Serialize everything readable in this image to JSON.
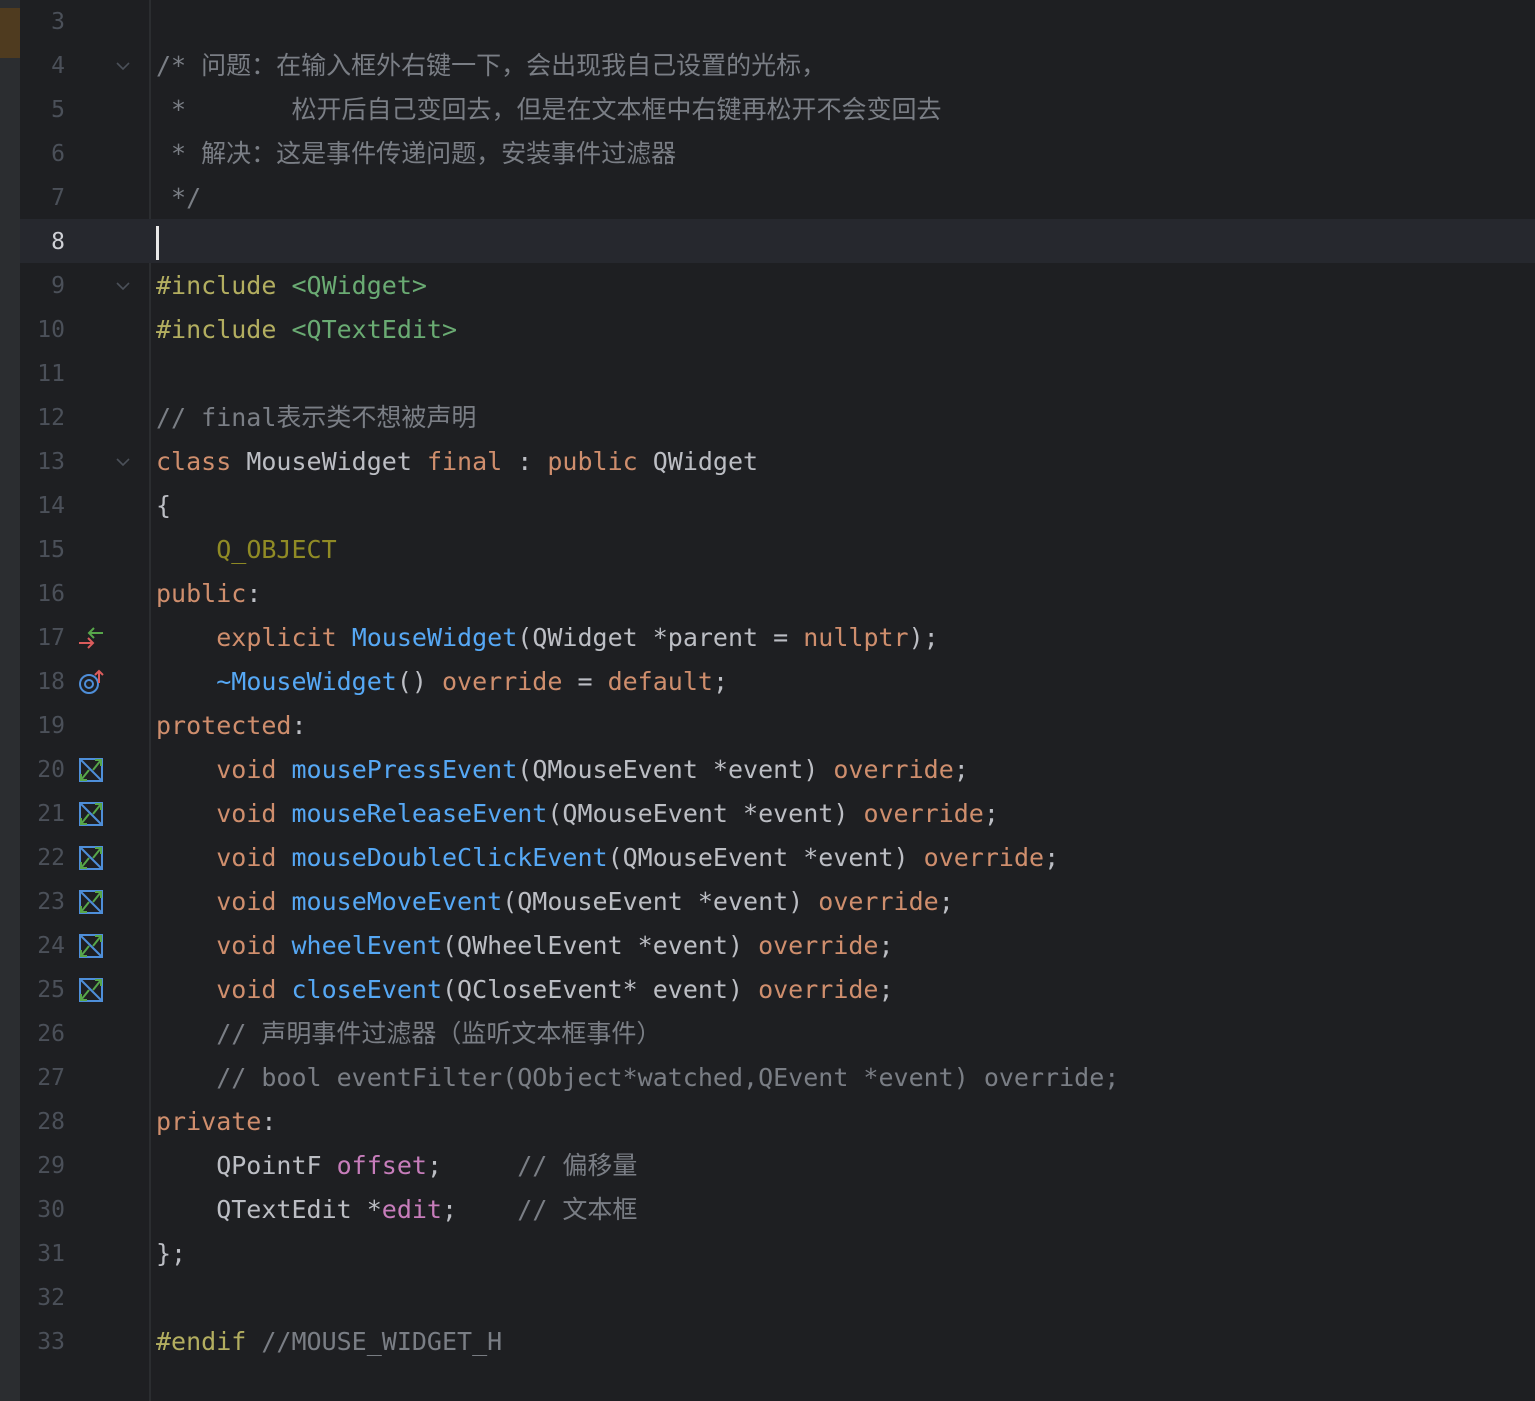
{
  "lines": [
    {
      "n": "3",
      "segs": []
    },
    {
      "n": "4",
      "fold": true,
      "segs": [
        {
          "t": "/* 问题：在输入框外右键一下，会出现我自己设置的光标，",
          "c": "com"
        }
      ]
    },
    {
      "n": "5",
      "segs": [
        {
          "t": " *       松开后自己变回去，但是在文本框中右键再松开不会变回去",
          "c": "com"
        }
      ]
    },
    {
      "n": "6",
      "segs": [
        {
          "t": " * 解决：这是事件传递问题，安装事件过滤器",
          "c": "com"
        }
      ]
    },
    {
      "n": "7",
      "segs": [
        {
          "t": " */",
          "c": "com"
        }
      ]
    },
    {
      "n": "8",
      "active": true,
      "caret": true,
      "segs": []
    },
    {
      "n": "9",
      "fold": true,
      "segs": [
        {
          "t": "#include ",
          "c": "pp"
        },
        {
          "t": "<QWidget>",
          "c": "str"
        }
      ]
    },
    {
      "n": "10",
      "segs": [
        {
          "t": "#include ",
          "c": "pp"
        },
        {
          "t": "<QTextEdit>",
          "c": "str"
        }
      ]
    },
    {
      "n": "11",
      "segs": []
    },
    {
      "n": "12",
      "segs": [
        {
          "t": "// final表示类不想被声明",
          "c": "com"
        }
      ]
    },
    {
      "n": "13",
      "fold": true,
      "segs": [
        {
          "t": "class ",
          "c": "kw"
        },
        {
          "t": "MouseWidget ",
          "c": "type"
        },
        {
          "t": "final ",
          "c": "kw"
        },
        {
          "t": ": ",
          "c": "punc"
        },
        {
          "t": "public ",
          "c": "kw"
        },
        {
          "t": "QWidget",
          "c": "type"
        }
      ]
    },
    {
      "n": "14",
      "segs": [
        {
          "t": "{",
          "c": "punc"
        }
      ]
    },
    {
      "n": "15",
      "segs": [
        {
          "t": "    ",
          "c": "punc"
        },
        {
          "t": "Q_OBJECT",
          "c": "macro"
        }
      ]
    },
    {
      "n": "16",
      "segs": [
        {
          "t": "public",
          "c": "kw"
        },
        {
          "t": ":",
          "c": "punc"
        }
      ]
    },
    {
      "n": "17",
      "icon": "override-arrows",
      "segs": [
        {
          "t": "    ",
          "c": "punc"
        },
        {
          "t": "explicit ",
          "c": "kw"
        },
        {
          "t": "MouseWidget",
          "c": "fn"
        },
        {
          "t": "(QWidget *parent = ",
          "c": "punc"
        },
        {
          "t": "nullptr",
          "c": "kw"
        },
        {
          "t": ");",
          "c": "punc"
        }
      ]
    },
    {
      "n": "18",
      "icon": "target-up",
      "segs": [
        {
          "t": "    ",
          "c": "punc"
        },
        {
          "t": "~MouseWidget",
          "c": "fn"
        },
        {
          "t": "() ",
          "c": "punc"
        },
        {
          "t": "override ",
          "c": "kw"
        },
        {
          "t": "= ",
          "c": "punc"
        },
        {
          "t": "default",
          "c": "kw"
        },
        {
          "t": ";",
          "c": "punc"
        }
      ]
    },
    {
      "n": "19",
      "segs": [
        {
          "t": "protected",
          "c": "kw"
        },
        {
          "t": ":",
          "c": "punc"
        }
      ]
    },
    {
      "n": "20",
      "icon": "implement",
      "segs": [
        {
          "t": "    ",
          "c": "punc"
        },
        {
          "t": "void ",
          "c": "kw"
        },
        {
          "t": "mousePressEvent",
          "c": "fn"
        },
        {
          "t": "(QMouseEvent *event) ",
          "c": "punc"
        },
        {
          "t": "override",
          "c": "kw"
        },
        {
          "t": ";",
          "c": "punc"
        }
      ]
    },
    {
      "n": "21",
      "icon": "implement",
      "segs": [
        {
          "t": "    ",
          "c": "punc"
        },
        {
          "t": "void ",
          "c": "kw"
        },
        {
          "t": "mouseReleaseEvent",
          "c": "fn"
        },
        {
          "t": "(QMouseEvent *event) ",
          "c": "punc"
        },
        {
          "t": "override",
          "c": "kw"
        },
        {
          "t": ";",
          "c": "punc"
        }
      ]
    },
    {
      "n": "22",
      "icon": "implement",
      "segs": [
        {
          "t": "    ",
          "c": "punc"
        },
        {
          "t": "void ",
          "c": "kw"
        },
        {
          "t": "mouseDoubleClickEvent",
          "c": "fn"
        },
        {
          "t": "(QMouseEvent *event) ",
          "c": "punc"
        },
        {
          "t": "override",
          "c": "kw"
        },
        {
          "t": ";",
          "c": "punc"
        }
      ]
    },
    {
      "n": "23",
      "icon": "implement",
      "segs": [
        {
          "t": "    ",
          "c": "punc"
        },
        {
          "t": "void ",
          "c": "kw"
        },
        {
          "t": "mouseMoveEvent",
          "c": "fn"
        },
        {
          "t": "(QMouseEvent *event) ",
          "c": "punc"
        },
        {
          "t": "override",
          "c": "kw"
        },
        {
          "t": ";",
          "c": "punc"
        }
      ]
    },
    {
      "n": "24",
      "icon": "implement",
      "segs": [
        {
          "t": "    ",
          "c": "punc"
        },
        {
          "t": "void ",
          "c": "kw"
        },
        {
          "t": "wheelEvent",
          "c": "fn"
        },
        {
          "t": "(QWheelEvent *event) ",
          "c": "punc"
        },
        {
          "t": "override",
          "c": "kw"
        },
        {
          "t": ";",
          "c": "punc"
        }
      ]
    },
    {
      "n": "25",
      "icon": "implement",
      "segs": [
        {
          "t": "    ",
          "c": "punc"
        },
        {
          "t": "void ",
          "c": "kw"
        },
        {
          "t": "closeEvent",
          "c": "fn"
        },
        {
          "t": "(QCloseEvent* event) ",
          "c": "punc"
        },
        {
          "t": "override",
          "c": "kw"
        },
        {
          "t": ";",
          "c": "punc"
        }
      ]
    },
    {
      "n": "26",
      "segs": [
        {
          "t": "    ",
          "c": "punc"
        },
        {
          "t": "// 声明事件过滤器（监听文本框事件）",
          "c": "com"
        }
      ]
    },
    {
      "n": "27",
      "segs": [
        {
          "t": "    ",
          "c": "punc"
        },
        {
          "t": "// bool eventFilter(QObject*watched,QEvent *event) override;",
          "c": "com"
        }
      ]
    },
    {
      "n": "28",
      "segs": [
        {
          "t": "private",
          "c": "kw"
        },
        {
          "t": ":",
          "c": "punc"
        }
      ]
    },
    {
      "n": "29",
      "segs": [
        {
          "t": "    QPointF ",
          "c": "type"
        },
        {
          "t": "offset",
          "c": "field"
        },
        {
          "t": ";     ",
          "c": "punc"
        },
        {
          "t": "// 偏移量",
          "c": "com"
        }
      ]
    },
    {
      "n": "30",
      "segs": [
        {
          "t": "    QTextEdit *",
          "c": "type"
        },
        {
          "t": "edit",
          "c": "field"
        },
        {
          "t": ";    ",
          "c": "punc"
        },
        {
          "t": "// 文本框",
          "c": "com"
        }
      ]
    },
    {
      "n": "31",
      "segs": [
        {
          "t": "};",
          "c": "punc"
        }
      ]
    },
    {
      "n": "32",
      "segs": []
    },
    {
      "n": "33",
      "segs": [
        {
          "t": "#endif ",
          "c": "pp"
        },
        {
          "t": "//MOUSE_WIDGET_H",
          "c": "com"
        }
      ]
    }
  ],
  "colors": {
    "background": "#1e1f22",
    "keyword": "#cf8e6d",
    "function": "#56a8f5",
    "string": "#6aab73",
    "comment": "#7a7e85",
    "preprocessor": "#b3ae60",
    "field": "#c77dbb"
  }
}
